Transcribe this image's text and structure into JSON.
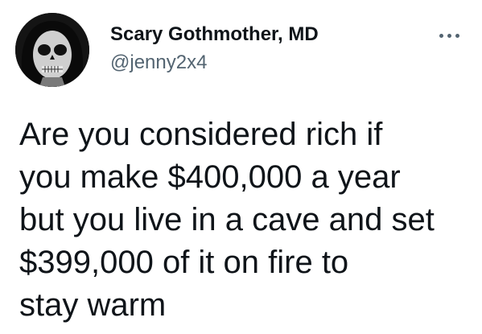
{
  "author": {
    "display_name": "Scary Gothmother, MD",
    "handle": "@jenny2x4",
    "avatar_icon": "skull-face-avatar"
  },
  "menu": {
    "icon": "more-options-icon"
  },
  "tweet": {
    "lines": [
      "Are you considered rich if",
      "you make $400,000 a year",
      "but you live in a cave and set",
      "$399,000 of it on fire to",
      "stay warm"
    ]
  },
  "colors": {
    "text_primary": "#0f1419",
    "text_secondary": "#536471",
    "background": "#ffffff"
  }
}
